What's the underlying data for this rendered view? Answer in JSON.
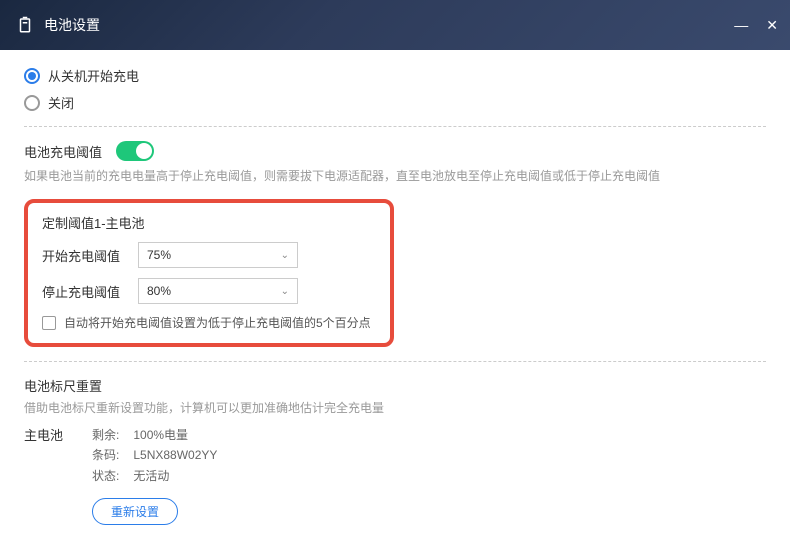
{
  "window": {
    "title": "电池设置"
  },
  "chargeMode": {
    "option1": "从关机开始充电",
    "option2": "关闭"
  },
  "threshold": {
    "label": "电池充电阈值",
    "enabled": true,
    "help": "如果电池当前的充电电量高于停止充电阈值，则需要拔下电源适配器，直至电池放电至停止充电阈值或低于停止充电阈值"
  },
  "custom": {
    "title": "定制阈值1-主电池",
    "startLabel": "开始充电阈值",
    "startValue": "75%",
    "stopLabel": "停止充电阈值",
    "stopValue": "80%",
    "autoLabel": "自动将开始充电阈值设置为低于停止充电阈值的5个百分点"
  },
  "gauge": {
    "title": "电池标尺重置",
    "help": "借助电池标尺重新设置功能，计算机可以更加准确地估计完全充电量"
  },
  "mainBattery": {
    "label": "主电池",
    "remainingKey": "剩余:",
    "remainingVal": "100%电量",
    "barcodeKey": "条码:",
    "barcodeVal": "L5NX88W02YY",
    "statusKey": "状态:",
    "statusVal": "无活动"
  },
  "buttons": {
    "reset": "重新设置"
  }
}
